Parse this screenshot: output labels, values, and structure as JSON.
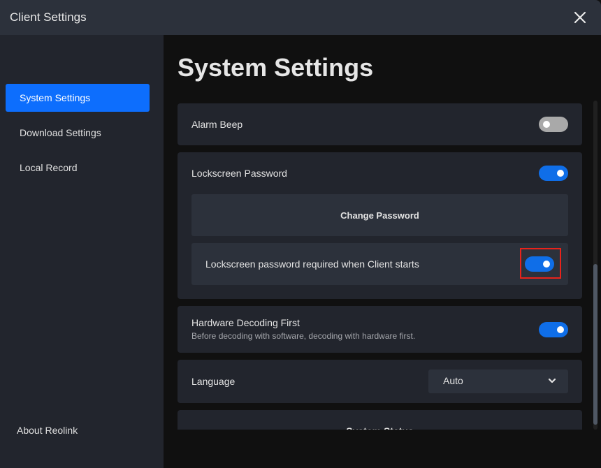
{
  "window": {
    "title": "Client Settings",
    "close_icon": "close-icon"
  },
  "sidebar": {
    "items": [
      {
        "label": "System Settings",
        "active": true
      },
      {
        "label": "Download Settings",
        "active": false
      },
      {
        "label": "Local Record",
        "active": false
      }
    ],
    "about_label": "About Reolink"
  },
  "main": {
    "title": "System Settings",
    "alarm_beep": {
      "label": "Alarm Beep",
      "enabled": false
    },
    "lockscreen": {
      "label": "Lockscreen Password",
      "enabled": true,
      "change_password_label": "Change Password",
      "required_on_start": {
        "label": "Lockscreen password required when Client starts",
        "enabled": true
      }
    },
    "hardware_decoding": {
      "label": "Hardware Decoding First",
      "description": "Before decoding with software, decoding with hardware first.",
      "enabled": true
    },
    "language": {
      "label": "Language",
      "selected": "Auto",
      "icon": "chevron-down-icon"
    },
    "system_status": {
      "label": "System Status"
    }
  },
  "colors": {
    "accent": "#0d6efd",
    "toggle_on": "#0f6ee8",
    "toggle_off": "#a9a9a9",
    "highlight": "#e8231b"
  }
}
